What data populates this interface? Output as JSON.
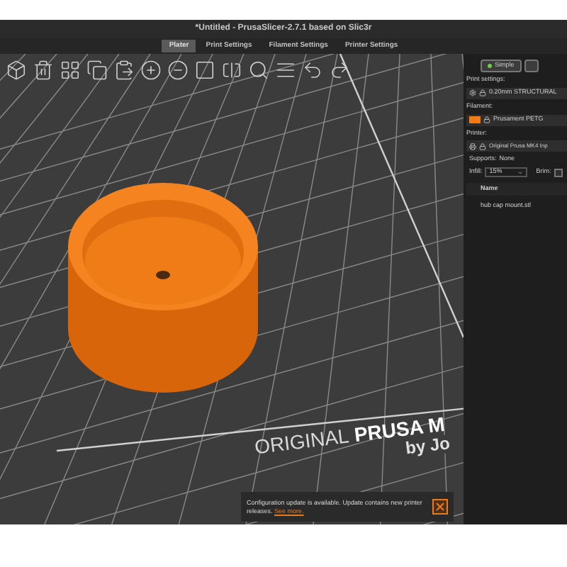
{
  "window": {
    "title": "*Untitled - PrusaSlicer-2.7.1 based on Slic3r"
  },
  "tabs": [
    {
      "label": "Plater",
      "selected": true
    },
    {
      "label": "Print Settings",
      "selected": false
    },
    {
      "label": "Filament Settings",
      "selected": false
    },
    {
      "label": "Printer Settings",
      "selected": false
    }
  ],
  "bed": {
    "logo_light": "ORIGINAL",
    "logo_bold": "PRUSA M",
    "subtitle": "by Jo"
  },
  "mode": {
    "label": "Simple",
    "selected": true
  },
  "sidebar": {
    "print_label": "Print settings:",
    "print_value": "0.20mm STRUCTURAL",
    "filament_label": "Filament:",
    "filament_value": "Prusament PETG",
    "printer_label": "Printer:",
    "printer_value": "Original Prusa MK4 Inp",
    "supports_label": "Supports:",
    "supports_value": "None",
    "infill_label": "Infill:",
    "infill_value": "15%",
    "brim_label": "Brim:",
    "brim_checked": false
  },
  "objects": {
    "columns": [
      "Name"
    ],
    "rows": [
      "hub cap mount.stl"
    ]
  },
  "notification": {
    "text": "Configuration update is available. Update contains new printer releases.",
    "link": "See more."
  }
}
